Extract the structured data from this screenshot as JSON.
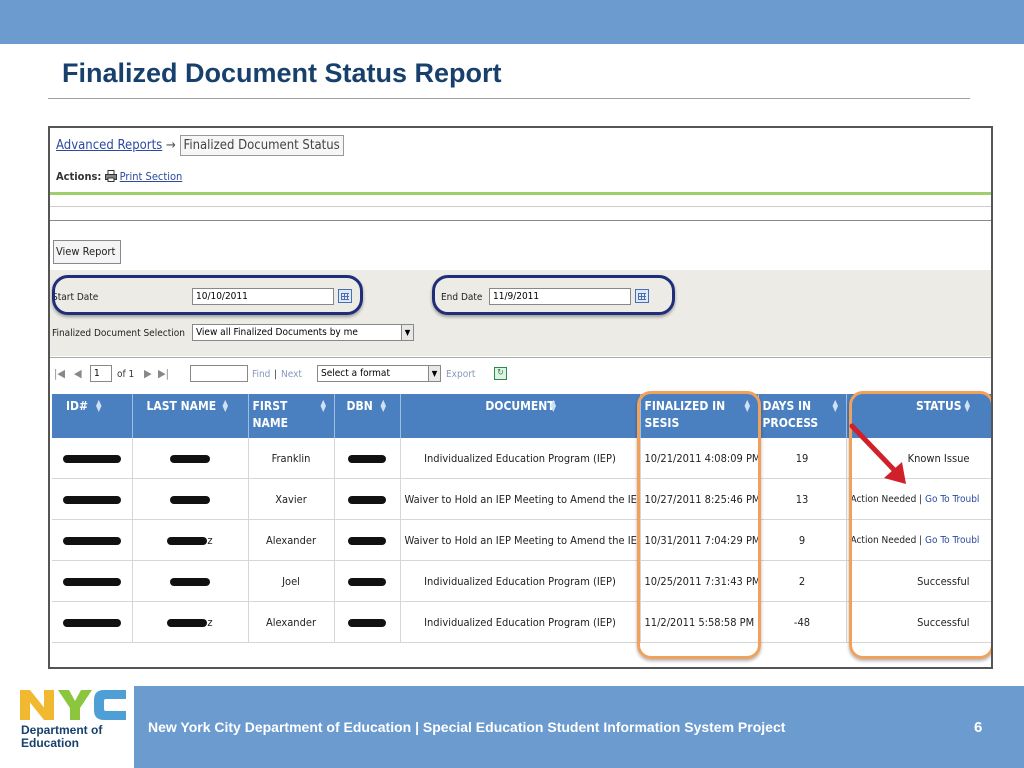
{
  "slide": {
    "title": "Finalized Document Status Report",
    "page_number": "6",
    "footer_text": "New York City Department of Education | Special Education Student Information System Project"
  },
  "logo": {
    "letters": "NYC",
    "line1": "Department of",
    "line2": "Education",
    "colors": {
      "n": "#f1b930",
      "y": "#8cc63e",
      "c": "#4d9fd6"
    }
  },
  "breadcrumb": {
    "parent": "Advanced Reports",
    "separator": "→",
    "current": "Finalized Document Status"
  },
  "actions": {
    "label": "Actions:",
    "print_label": "Print Section"
  },
  "view_report_label": "View Report",
  "filters": {
    "start_date_label": "Start Date",
    "start_date_value": "10/10/2011",
    "end_date_label": "End Date",
    "end_date_value": "11/9/2011",
    "selection_label": "Finalized Document Selection",
    "selection_value": "View all Finalized Documents by me"
  },
  "pager": {
    "page_value": "1",
    "of_label": "of 1",
    "find_label": "Find",
    "separator": "|",
    "next_label": "Next",
    "format_value": "Select a format",
    "export_label": "Export"
  },
  "table": {
    "headers": {
      "id": "ID#",
      "last_name": "LAST NAME",
      "first_name_1": "FIRST",
      "first_name_2": "NAME",
      "dbn": "DBN",
      "document": "DOCUMENT",
      "finalized_1": "FINALIZED IN",
      "finalized_2": "SESIS",
      "days_1": "DAYS IN",
      "days_2": "PROCESS",
      "status": "STATUS"
    },
    "rows": [
      {
        "last_suffix": "",
        "first": "Franklin",
        "document": "Individualized Education Program (IEP)",
        "finalized": "10/21/2011 4:08:09 PM",
        "days": "19",
        "status": "Known Issue",
        "status_link": ""
      },
      {
        "last_suffix": "",
        "first": "Xavier",
        "document": "Waiver to Hold an IEP Meeting to Amend the IEP",
        "finalized": "10/27/2011 8:25:46 PM",
        "days": "13",
        "status": "Action Needed",
        "status_link": "Go To Troubl"
      },
      {
        "last_suffix": "z",
        "first": "Alexander",
        "document": "Waiver to Hold an IEP Meeting to Amend the IEP",
        "finalized": "10/31/2011 7:04:29 PM",
        "days": "9",
        "status": "Action Needed",
        "status_link": "Go To Troubl"
      },
      {
        "last_suffix": "",
        "first": "Joel",
        "document": "Individualized Education Program (IEP)",
        "finalized": "10/25/2011 7:31:43 PM",
        "days": "2",
        "status": "Successful",
        "status_link": ""
      },
      {
        "last_suffix": "z",
        "first": "Alexander",
        "document": "Individualized Education Program (IEP)",
        "finalized": "11/2/2011 5:58:58 PM",
        "days": "-48",
        "status": "Successful",
        "status_link": ""
      }
    ]
  },
  "colors": {
    "header_band": "#6b9bcf",
    "title": "#17406d",
    "grid_header": "#4a7fc0",
    "highlight_blue": "#1f2d7a",
    "highlight_orange": "#f0a25c",
    "arrow_red": "#d0202a"
  }
}
